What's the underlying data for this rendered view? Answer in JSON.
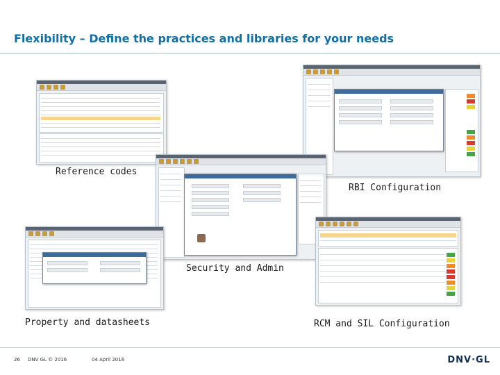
{
  "slide": {
    "title": "Flexibility – Define the practices and libraries for your needs"
  },
  "captions": {
    "reference_codes": "Reference codes",
    "rbi_configuration": "RBI Configuration",
    "security_admin": "Security and Admin",
    "property_datasheets": "Property and datasheets",
    "rcm_sil": "RCM and SIL Configuration"
  },
  "footer": {
    "page_number": "26",
    "copyright": "DNV GL © 2016",
    "date": "04 April 2016",
    "logo_text": "DNV·GL"
  },
  "colors": {
    "title": "#0f6fa6",
    "risk_green": "#47a548",
    "risk_yellow": "#e7d33b",
    "risk_orange": "#ee8b2a",
    "risk_red": "#d53c2f"
  }
}
